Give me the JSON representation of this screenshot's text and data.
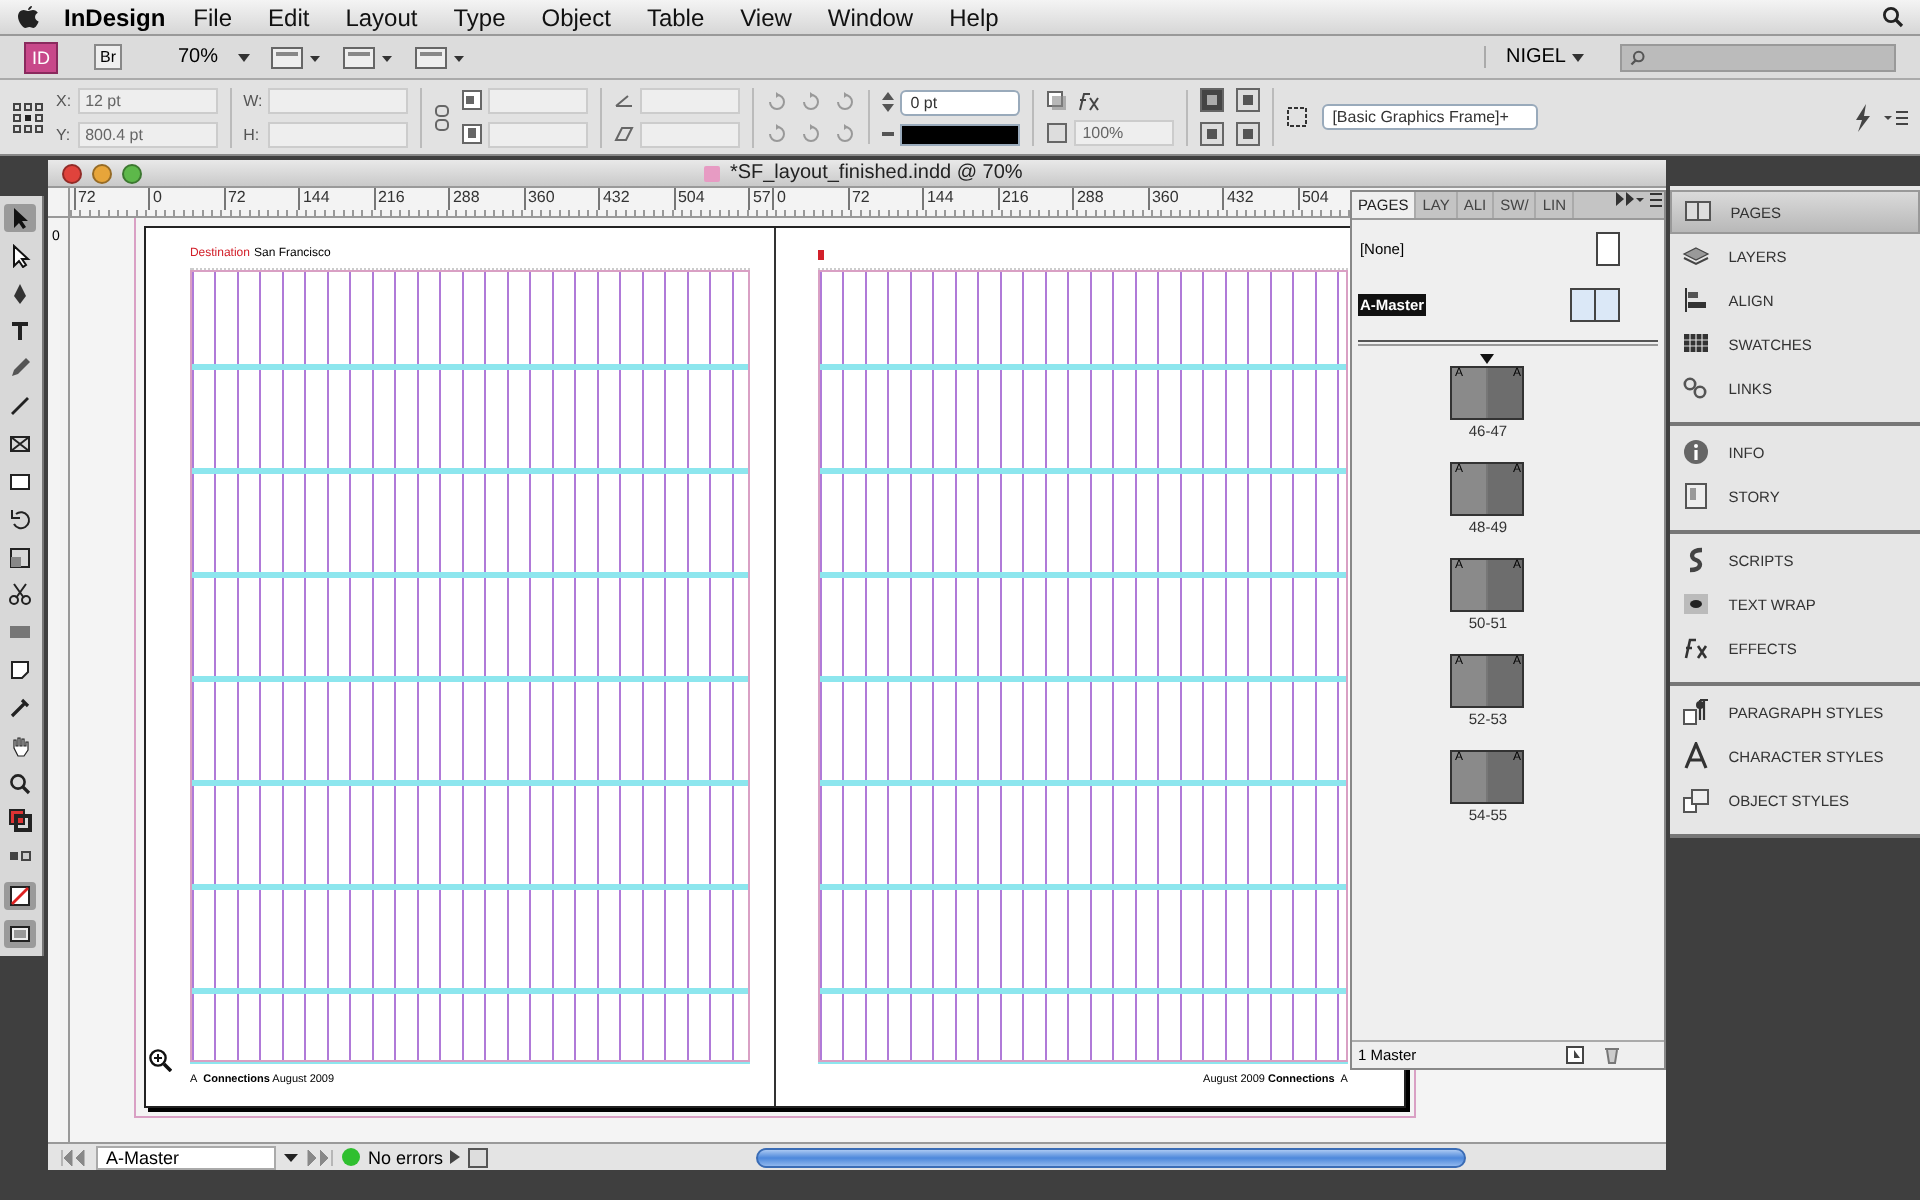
{
  "menu_bar": {
    "app": "InDesign",
    "menus": [
      "File",
      "Edit",
      "Layout",
      "Type",
      "Object",
      "Table",
      "View",
      "Window",
      "Help"
    ]
  },
  "app_bar": {
    "app_badge": "ID",
    "bridge_badge": "Br",
    "zoom": "70%",
    "workspace": "NIGEL"
  },
  "control_panel": {
    "x_label": "X:",
    "x_value": "12 pt",
    "y_label": "Y:",
    "y_value": "800.4 pt",
    "w_label": "W:",
    "h_label": "H:",
    "stroke_weight": "0 pt",
    "opacity": "100%",
    "object_style": "[Basic Graphics Frame]+"
  },
  "tools": [
    {
      "kind": "selection",
      "selected": true
    },
    {
      "kind": "direct",
      "selected": false
    },
    {
      "kind": "pen",
      "selected": false
    },
    {
      "kind": "type",
      "selected": false
    },
    {
      "kind": "pencil",
      "selected": false
    },
    {
      "kind": "line",
      "selected": false
    },
    {
      "kind": "frame",
      "selected": false
    },
    {
      "kind": "rectangle",
      "selected": false
    },
    {
      "kind": "rotate",
      "selected": false
    },
    {
      "kind": "scale",
      "selected": false
    },
    {
      "kind": "scissors",
      "selected": false
    },
    {
      "kind": "gradient",
      "selected": false
    },
    {
      "kind": "note",
      "selected": false
    },
    {
      "kind": "eyedropper",
      "selected": false
    },
    {
      "kind": "hand",
      "selected": false
    },
    {
      "kind": "zoom",
      "selected": false
    },
    {
      "kind": "swatch",
      "selected": false
    },
    {
      "kind": "apply",
      "selected": false
    },
    {
      "kind": "none",
      "selected": true
    },
    {
      "kind": "view",
      "selected": true
    }
  ],
  "document": {
    "title": "*SF_layout_finished.indd @ 70%",
    "ruler": [
      "72",
      "0",
      "72",
      "144",
      "216",
      "288",
      "360",
      "432",
      "504",
      "57",
      "0",
      "72",
      "144",
      "216",
      "288",
      "360",
      "432",
      "504"
    ],
    "vertical_ruler": [
      "0"
    ],
    "left_page": {
      "header_section": "Destination",
      "header_title": "San Francisco",
      "footer_marker": "A",
      "footer_text": "**Connections** August 2009"
    },
    "right_page": {
      "footer_text": "August 2009 **Connections**",
      "footer_marker": "A"
    }
  },
  "pages_panel": {
    "tabs": [
      {
        "label": "PAGES",
        "selected": true
      },
      {
        "label": "LAY",
        "selected": false
      },
      {
        "label": "ALI",
        "selected": false
      },
      {
        "label": "SW/",
        "selected": false
      },
      {
        "label": "LIN",
        "selected": false
      }
    ],
    "masters": [
      {
        "label": "[None]",
        "kind": "none",
        "selected": false
      },
      {
        "label": "A-Master",
        "kind": "spread",
        "selected": true
      }
    ],
    "spreads": [
      {
        "label": "46-47",
        "left_master": "A",
        "right_master": "A",
        "current": true
      },
      {
        "label": "48-49",
        "left_master": "A",
        "right_master": "A",
        "current": false
      },
      {
        "label": "50-51",
        "left_master": "A",
        "right_master": "A",
        "current": false
      },
      {
        "label": "52-53",
        "left_master": "A",
        "right_master": "A",
        "current": false
      },
      {
        "label": "54-55",
        "left_master": "A",
        "right_master": "A",
        "current": false
      }
    ],
    "footer": "1 Master"
  },
  "dock": {
    "groups": [
      [
        {
          "label": "PAGES",
          "kind": "pages",
          "selected": true
        },
        {
          "label": "LAYERS",
          "kind": "layers",
          "selected": false
        },
        {
          "label": "ALIGN",
          "kind": "align",
          "selected": false
        },
        {
          "label": "SWATCHES",
          "kind": "swatches",
          "selected": false
        },
        {
          "label": "LINKS",
          "kind": "links",
          "selected": false
        }
      ],
      [
        {
          "label": "INFO",
          "kind": "info",
          "selected": false
        },
        {
          "label": "STORY",
          "kind": "story",
          "selected": false
        }
      ],
      [
        {
          "label": "SCRIPTS",
          "kind": "scripts",
          "selected": false
        },
        {
          "label": "TEXT WRAP",
          "kind": "wrap",
          "selected": false
        },
        {
          "label": "EFFECTS",
          "kind": "effects",
          "selected": false
        }
      ],
      [
        {
          "label": "PARAGRAPH STYLES",
          "kind": "paragraph",
          "selected": false
        },
        {
          "label": "CHARACTER STYLES",
          "kind": "character",
          "selected": false
        },
        {
          "label": "OBJECT STYLES",
          "kind": "object",
          "selected": false
        }
      ]
    ]
  },
  "status_bar": {
    "page": "A-Master",
    "preflight": "No errors",
    "preflight_ok": true
  }
}
